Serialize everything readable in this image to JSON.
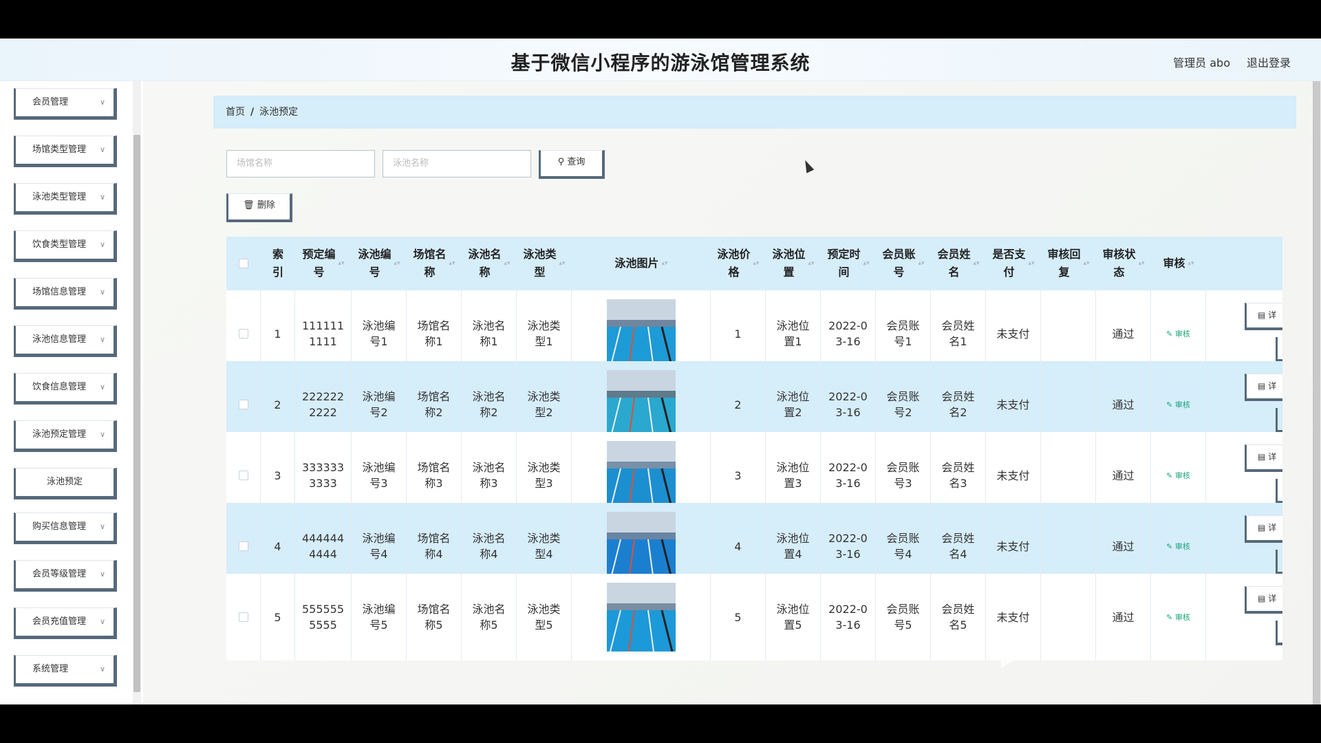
{
  "header": {
    "title": "基于微信小程序的游泳馆管理系统",
    "admin": "管理员 abo",
    "logout": "退出登录"
  },
  "sidebar": {
    "items": [
      {
        "label": "会员管理"
      },
      {
        "label": "场馆类型管理"
      },
      {
        "label": "泳池类型管理"
      },
      {
        "label": "饮食类型管理"
      },
      {
        "label": "场馆信息管理"
      },
      {
        "label": "泳池信息管理"
      },
      {
        "label": "饮食信息管理"
      },
      {
        "label": "泳池预定管理"
      },
      {
        "label": "泳池预定",
        "sub": true
      },
      {
        "label": "购买信息管理"
      },
      {
        "label": "会员等级管理"
      },
      {
        "label": "会员充值管理"
      },
      {
        "label": "系统管理"
      }
    ]
  },
  "breadcrumb": {
    "home": "首页",
    "sep": "/",
    "current": "泳池预定"
  },
  "search": {
    "venue_placeholder": "场馆名称",
    "pool_placeholder": "泳池名称",
    "query_label": "查询",
    "delete_label": "删除"
  },
  "table": {
    "headers": [
      "索引",
      "预定编号",
      "泳池编号",
      "场馆名称",
      "泳池名称",
      "泳池类型",
      "泳池图片",
      "泳池价格",
      "泳池位置",
      "预定时间",
      "会员账号",
      "会员姓名",
      "是否支付",
      "审核回复",
      "审核状态",
      "审核"
    ],
    "header_display": [
      "索\n引",
      "预定编\n号",
      "泳池编\n号",
      "场馆名\n称",
      "泳池名\n称",
      "泳池类\n型",
      "泳池图片",
      "泳池价\n格",
      "泳池位\n置",
      "预定时\n间",
      "会员账\n号",
      "会员姓\n名",
      "是否支\n付",
      "审核回\n复",
      "审核状\n态",
      "审核"
    ],
    "rows": [
      {
        "index": "1",
        "order_no": "111111\n1111",
        "pool_no": "泳池编\n号1",
        "venue": "场馆名\n称1",
        "pool_name": "泳池名\n称1",
        "pool_type": "泳池类\n型1",
        "price": "1",
        "location": "泳池位\n置1",
        "time": "2022-0\n3-16",
        "account": "会员账\n号1",
        "member": "会员姓\n名1",
        "paid": "未支付",
        "reply": "",
        "status": "通过",
        "review": "审核",
        "detail": "详"
      },
      {
        "index": "2",
        "order_no": "222222\n2222",
        "pool_no": "泳池编\n号2",
        "venue": "场馆名\n称2",
        "pool_name": "泳池名\n称2",
        "pool_type": "泳池类\n型2",
        "price": "2",
        "location": "泳池位\n置2",
        "time": "2022-0\n3-16",
        "account": "会员账\n号2",
        "member": "会员姓\n名2",
        "paid": "未支付",
        "reply": "",
        "status": "通过",
        "review": "审核",
        "detail": "详"
      },
      {
        "index": "3",
        "order_no": "333333\n3333",
        "pool_no": "泳池编\n号3",
        "venue": "场馆名\n称3",
        "pool_name": "泳池名\n称3",
        "pool_type": "泳池类\n型3",
        "price": "3",
        "location": "泳池位\n置3",
        "time": "2022-0\n3-16",
        "account": "会员账\n号3",
        "member": "会员姓\n名3",
        "paid": "未支付",
        "reply": "",
        "status": "通过",
        "review": "审核",
        "detail": "详"
      },
      {
        "index": "4",
        "order_no": "444444\n4444",
        "pool_no": "泳池编\n号4",
        "venue": "场馆名\n称4",
        "pool_name": "泳池名\n称4",
        "pool_type": "泳池类\n型4",
        "price": "4",
        "location": "泳池位\n置4",
        "time": "2022-0\n3-16",
        "account": "会员账\n号4",
        "member": "会员姓\n名4",
        "paid": "未支付",
        "reply": "",
        "status": "通过",
        "review": "审核",
        "detail": "详"
      },
      {
        "index": "5",
        "order_no": "555555\n5555",
        "pool_no": "泳池编\n号5",
        "venue": "场馆名\n称5",
        "pool_name": "泳池名\n称5",
        "pool_type": "泳池类\n型5",
        "price": "5",
        "location": "泳池位\n置5",
        "time": "2022-0\n3-16",
        "account": "会员账\n号5",
        "member": "会员姓\n名5",
        "paid": "未支付",
        "reply": "",
        "status": "通过",
        "review": "审核",
        "detail": "详"
      }
    ]
  },
  "colors": {
    "accent": "#d6edfa",
    "border_dark": "#56697a",
    "review_green": "#1aa67a"
  },
  "icons": {
    "query": "search-icon",
    "delete": "trash-icon",
    "review": "edit-icon",
    "detail": "document-icon",
    "chevron": "chevron-down-icon"
  }
}
